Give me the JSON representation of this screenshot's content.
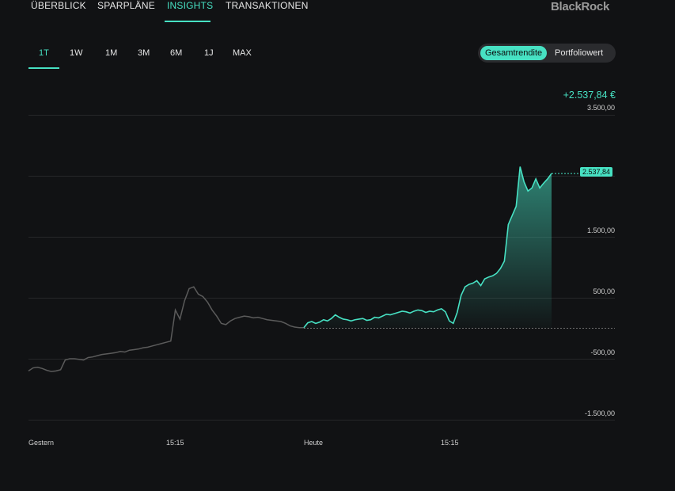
{
  "nav": {
    "tabs": [
      {
        "label": "ÜBERBLICK"
      },
      {
        "label": "SPARPLÄNE"
      },
      {
        "label": "INSIGHTS"
      },
      {
        "label": "TRANSAKTIONEN"
      }
    ],
    "active": "INSIGHTS",
    "brand": "BlackRock"
  },
  "ranges": [
    "1T",
    "1W",
    "1M",
    "3M",
    "6M",
    "1J",
    "MAX"
  ],
  "active_range": "1T",
  "toggle": {
    "options": [
      "Gesamtrendite",
      "Portfoliowert"
    ],
    "active": "Gesamtrendite"
  },
  "total": "+2.537,84 €",
  "badge": "2.537,84",
  "accent_color": "#47e1c3",
  "chart_data": {
    "type": "area",
    "ylim": [
      -1500,
      3500
    ],
    "yticks": [
      "3.500,00",
      "1.500,00",
      "500,00",
      "-500,00",
      "-1.500,00"
    ],
    "xtick_labels": [
      "Gestern",
      "15:15",
      "Heute",
      "15:15"
    ],
    "series": [
      {
        "values": [
          -700,
          -650,
          -640,
          -660,
          -690,
          -710,
          -700,
          -680,
          -520,
          -500,
          -500,
          -510,
          -520,
          -480,
          -470,
          -450,
          -430,
          -420,
          -410,
          -400,
          -380,
          -390,
          -360,
          -350,
          -340,
          -320,
          -310,
          -290,
          -270,
          -250,
          -230,
          -210,
          300,
          150,
          450,
          650,
          680,
          560,
          520,
          430,
          300,
          200,
          80,
          60,
          120,
          160,
          180,
          200,
          190,
          170,
          180,
          160,
          140,
          130,
          120,
          110,
          80,
          40,
          20,
          10,
          10,
          90,
          110,
          80,
          100,
          140,
          120,
          160,
          220,
          180,
          150,
          140,
          120,
          140,
          150,
          160,
          130,
          140,
          180,
          170,
          200,
          230,
          220,
          240,
          260,
          280,
          270,
          250,
          280,
          300,
          290,
          260,
          280,
          270,
          300,
          320,
          270,
          120,
          80,
          260,
          540,
          680,
          720,
          740,
          780,
          700,
          810,
          840,
          860,
          900,
          980,
          1100,
          1700,
          1850,
          2000,
          2650,
          2400,
          2250,
          2300,
          2450,
          2300,
          2380,
          2450,
          2537.84
        ]
      }
    ],
    "split_index": 60,
    "baseline": 0,
    "last_value": 2537.84
  }
}
